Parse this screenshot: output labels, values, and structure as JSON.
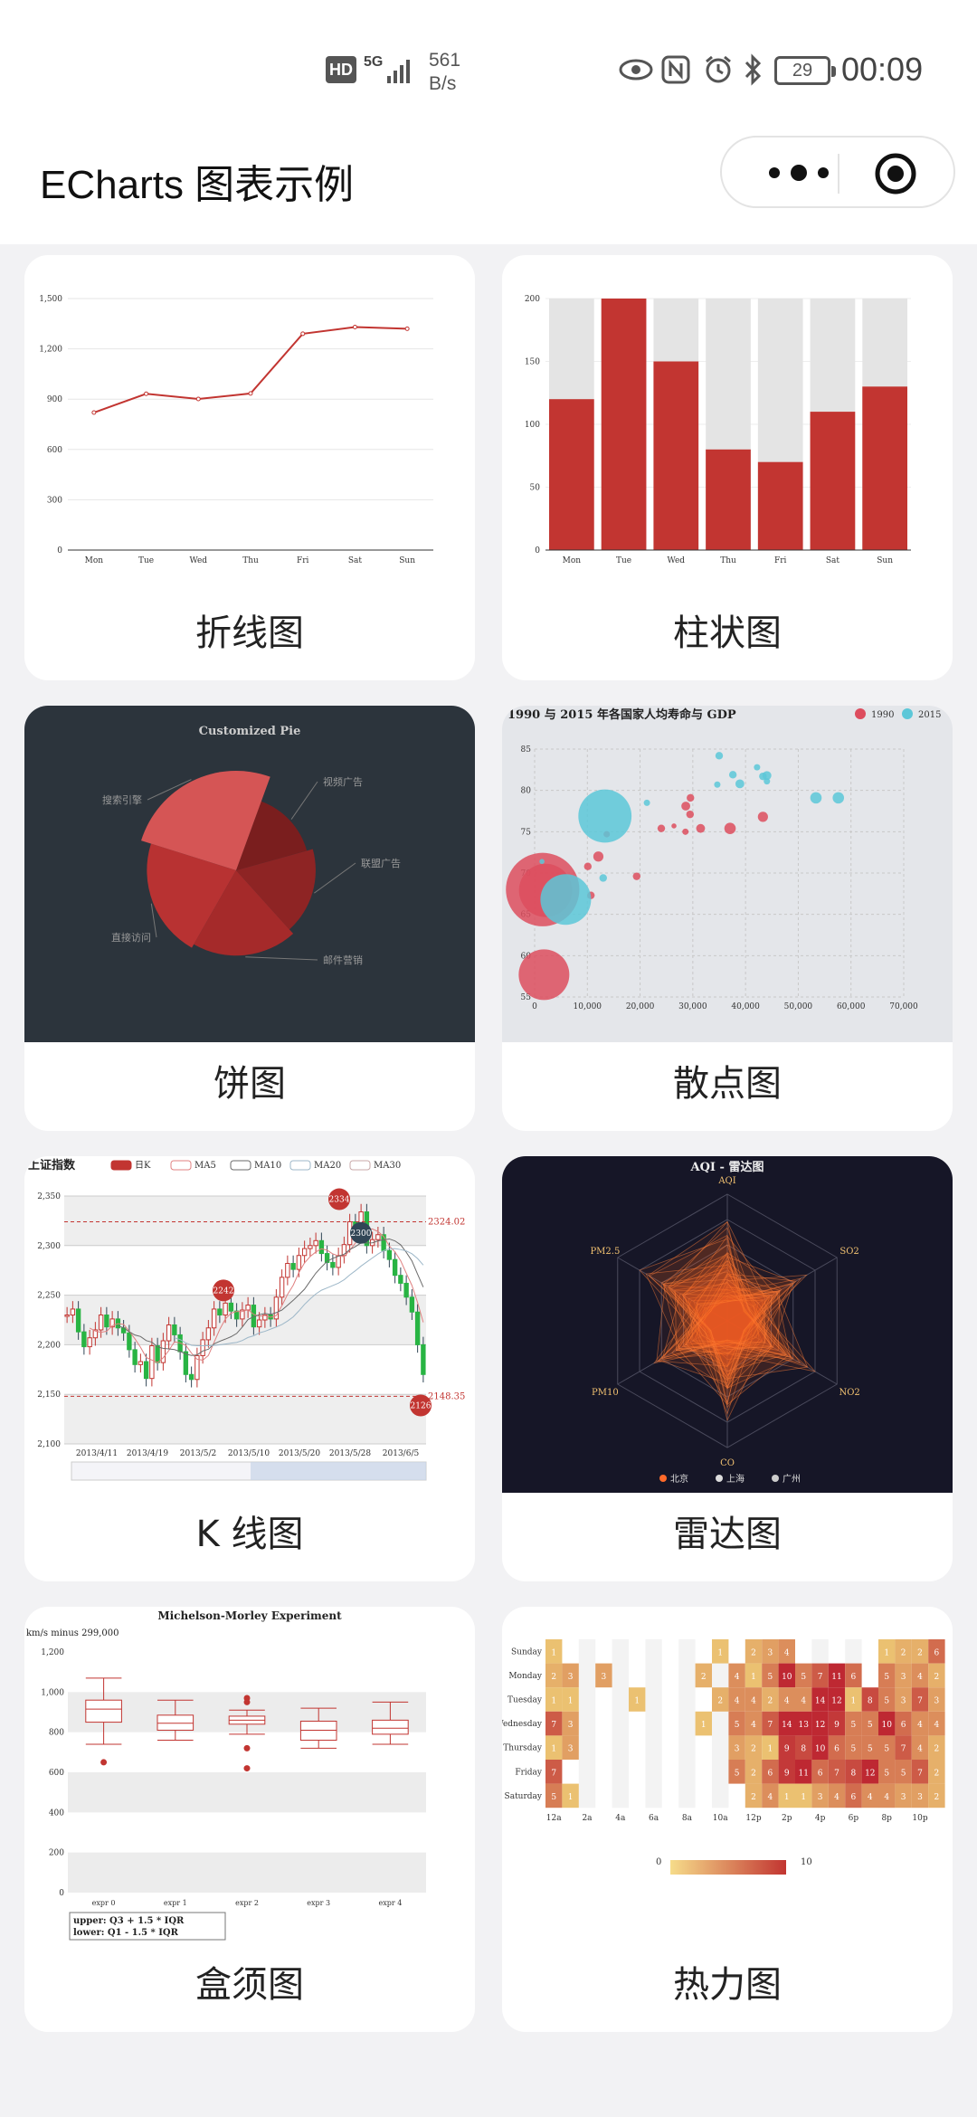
{
  "status_bar": {
    "hd": "HD",
    "network": "5G",
    "speed_value": "561",
    "speed_unit": "B/s",
    "battery": "29",
    "time": "00:09",
    "icons": [
      "eye-icon",
      "nfc-icon",
      "alarm-icon",
      "bluetooth-icon",
      "battery-icon"
    ]
  },
  "header": {
    "title": "ECharts 图表示例",
    "more_icon": "more-dots-icon",
    "close_icon": "target-icon"
  },
  "cards": [
    {
      "label": "折线图"
    },
    {
      "label": "柱状图"
    },
    {
      "label": "饼图"
    },
    {
      "label": "散点图"
    },
    {
      "label": "K 线图"
    },
    {
      "label": "雷达图"
    },
    {
      "label": "盒须图"
    },
    {
      "label": "热力图"
    }
  ],
  "chart_data": [
    {
      "type": "line",
      "categories": [
        "Mon",
        "Tue",
        "Wed",
        "Thu",
        "Fri",
        "Sat",
        "Sun"
      ],
      "values": [
        820,
        932,
        901,
        934,
        1290,
        1330,
        1320
      ],
      "yticks": [
        "0",
        "300",
        "600",
        "900",
        "1,200",
        "1,500"
      ],
      "ylim": [
        0,
        1500
      ],
      "color": "#c23531"
    },
    {
      "type": "bar",
      "categories": [
        "Mon",
        "Tue",
        "Wed",
        "Thu",
        "Fri",
        "Sat",
        "Sun"
      ],
      "values": [
        120,
        200,
        150,
        80,
        70,
        110,
        130
      ],
      "background_value": 200,
      "yticks": [
        "0",
        "50",
        "100",
        "150",
        "200"
      ],
      "ylim": [
        0,
        200
      ],
      "color": "#c23531"
    },
    {
      "type": "pie",
      "title": "Customized Pie",
      "labels": [
        "搜索引擎",
        "视频广告",
        "联盟广告",
        "邮件营销",
        "直接访问"
      ],
      "values": [
        400,
        235,
        274,
        310,
        335
      ],
      "background": "#2c343c"
    },
    {
      "type": "scatter",
      "title": "1990 与 2015 年各国家人均寿命与 GDP",
      "legend": [
        "1990",
        "2015"
      ],
      "xticks": [
        "0",
        "10,000",
        "20,000",
        "30,000",
        "40,000",
        "50,000",
        "60,000",
        "70,000"
      ],
      "yticks": [
        "55",
        "60",
        "65",
        "70",
        "75",
        "80",
        "85"
      ],
      "xlim": [
        0,
        70000
      ],
      "ylim": [
        55,
        85
      ],
      "series": [
        {
          "name": "1990",
          "color": "#dd4d5e",
          "points": [
            [
              1516,
              68,
              58
            ],
            [
              13670,
              74.7,
              5
            ],
            [
              28599,
              75,
              5
            ],
            [
              29476,
              77.1,
              6
            ],
            [
              31476,
              75.4,
              7
            ],
            [
              28666,
              78.1,
              7
            ],
            [
              1777,
              57.7,
              40
            ],
            [
              29550,
              79.1,
              6
            ],
            [
              2076,
              67.9,
              42
            ],
            [
              12087,
              72,
              8
            ],
            [
              24021,
              75.4,
              6
            ],
            [
              43296,
              76.8,
              8
            ],
            [
              10088,
              70.8,
              6
            ],
            [
              19349,
              69.6,
              6
            ],
            [
              10670,
              67.3,
              6
            ],
            [
              26424,
              75.7,
              4
            ],
            [
              37062,
              75.4,
              9
            ]
          ]
        },
        {
          "name": "2015",
          "color": "#5cc7d8",
          "points": [
            [
              44056,
              81.8,
              7
            ],
            [
              43294,
              81.7,
              6
            ],
            [
              13334,
              76.9,
              42
            ],
            [
              21291,
              78.5,
              5
            ],
            [
              38923,
              80.8,
              7
            ],
            [
              37599,
              81.9,
              6
            ],
            [
              44053,
              81.1,
              5
            ],
            [
              42182,
              82.8,
              5
            ],
            [
              5903,
              66.8,
              40
            ],
            [
              13000,
              69.4,
              6
            ],
            [
              57599,
              79.1,
              9
            ],
            [
              53354,
              79.1,
              9
            ],
            [
              35000,
              84.2,
              6
            ],
            [
              1390,
              71.4,
              4
            ],
            [
              34644,
              80.7,
              5
            ]
          ]
        }
      ]
    },
    {
      "type": "candlestick",
      "title": "上证指数",
      "legend": [
        "日K",
        "MA5",
        "MA10",
        "MA20",
        "MA30"
      ],
      "xticks": [
        "2013/4/11",
        "2013/4/19",
        "2013/5/2",
        "2013/5/10",
        "2013/5/20",
        "2013/5/28",
        "2013/6/5"
      ],
      "yticks": [
        "2,100",
        "2,150",
        "2,200",
        "2,250",
        "2,300",
        "2,350"
      ],
      "ylim": [
        2100,
        2350
      ],
      "markers": [
        "2334",
        "2300",
        "2242",
        "2126"
      ],
      "marklines": [
        "2324.02",
        "2148.35"
      ],
      "closes": [
        2230,
        2236,
        2213,
        2198,
        2207,
        2215,
        2230,
        2218,
        2226,
        2217,
        2212,
        2195,
        2180,
        2183,
        2166,
        2199,
        2182,
        2204,
        2220,
        2210,
        2193,
        2170,
        2165,
        2189,
        2205,
        2217,
        2236,
        2230,
        2242,
        2234,
        2226,
        2235,
        2240,
        2218,
        2225,
        2230,
        2226,
        2248,
        2268,
        2282,
        2276,
        2290,
        2297,
        2300,
        2305,
        2292,
        2283,
        2278,
        2290,
        2301,
        2324,
        2320,
        2334,
        2300,
        2306,
        2311,
        2295,
        2286,
        2270,
        2262,
        2248,
        2233,
        2200,
        2170
      ]
    },
    {
      "type": "radar",
      "title": "AQI - 雷达图",
      "indicators": [
        "AQI",
        "SO2",
        "NO2",
        "CO",
        "PM10",
        "PM2.5"
      ],
      "legend": [
        "北京",
        "上海",
        "广州"
      ],
      "background": "#161627"
    },
    {
      "type": "boxplot",
      "title": "Michelson-Morley Experiment",
      "ylabel": "km/s minus 299,000",
      "categories": [
        "expr 0",
        "expr 1",
        "expr 2",
        "expr 3",
        "expr 4"
      ],
      "yticks": [
        "0",
        "200",
        "400",
        "600",
        "800",
        "1,000",
        "1,200"
      ],
      "ylim": [
        0,
        1200
      ],
      "boxes": [
        [
          740,
          850,
          915,
          960,
          1070
        ],
        [
          760,
          810,
          845,
          885,
          960
        ],
        [
          790,
          840,
          860,
          880,
          910
        ],
        [
          720,
          760,
          810,
          855,
          920
        ],
        [
          740,
          790,
          820,
          860,
          950
        ]
      ],
      "outliers": [
        [
          0,
          650
        ],
        [
          2,
          720
        ],
        [
          2,
          620
        ],
        [
          2,
          970
        ],
        [
          2,
          950
        ]
      ],
      "note": [
        "upper: Q3 + 1.5 * IQR",
        "lower: Q1 - 1.5 * IQR"
      ]
    },
    {
      "type": "heatmap",
      "days": [
        "Sunday",
        "Monday",
        "Tuesday",
        "Wednesday",
        "Thursday",
        "Friday",
        "Saturday"
      ],
      "hours_ticks": [
        "12a",
        "2a",
        "4a",
        "6a",
        "8a",
        "10a",
        "12p",
        "2p",
        "4p",
        "6p",
        "8p",
        "10p"
      ],
      "visual_range": [
        "0",
        "10"
      ],
      "rows": [
        [
          1,
          0,
          0,
          0,
          0,
          0,
          0,
          0,
          0,
          0,
          1,
          0,
          2,
          3,
          4,
          0,
          0,
          0,
          0,
          0,
          1,
          2,
          2,
          6
        ],
        [
          2,
          3,
          0,
          3,
          0,
          0,
          0,
          0,
          0,
          2,
          0,
          4,
          1,
          5,
          10,
          5,
          7,
          11,
          6,
          0,
          5,
          3,
          4,
          2
        ],
        [
          1,
          1,
          0,
          0,
          0,
          1,
          0,
          0,
          0,
          0,
          2,
          4,
          4,
          2,
          4,
          4,
          14,
          12,
          1,
          8,
          5,
          3,
          7,
          3
        ],
        [
          7,
          3,
          0,
          0,
          0,
          0,
          0,
          0,
          0,
          1,
          0,
          5,
          4,
          7,
          14,
          13,
          12,
          9,
          5,
          5,
          10,
          6,
          4,
          4
        ],
        [
          1,
          3,
          0,
          0,
          0,
          0,
          0,
          0,
          0,
          0,
          0,
          3,
          2,
          1,
          9,
          8,
          10,
          6,
          5,
          5,
          5,
          7,
          4,
          2
        ],
        [
          7,
          0,
          0,
          0,
          0,
          0,
          0,
          0,
          0,
          0,
          0,
          5,
          2,
          6,
          9,
          11,
          6,
          7,
          8,
          12,
          5,
          5,
          7,
          2
        ],
        [
          5,
          1,
          0,
          0,
          0,
          0,
          0,
          0,
          0,
          0,
          0,
          0,
          2,
          4,
          1,
          1,
          3,
          4,
          6,
          4,
          4,
          3,
          3,
          2
        ]
      ]
    }
  ]
}
